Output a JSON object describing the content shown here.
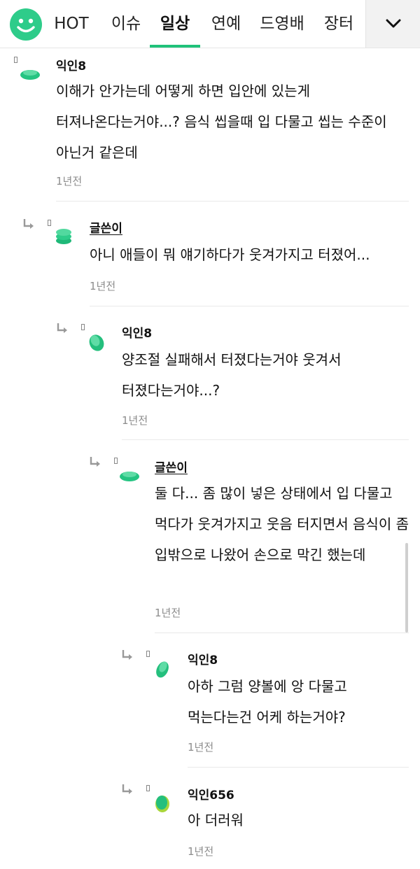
{
  "tabs": [
    {
      "label": "HOT"
    },
    {
      "label": "이슈"
    },
    {
      "label": "일상"
    },
    {
      "label": "연예"
    },
    {
      "label": "드영배"
    },
    {
      "label": "장터"
    }
  ],
  "active_tab": "일상",
  "accent_color": "#20c27a",
  "comments": [
    {
      "author": "익인8",
      "text": "이해가 안가는데 어떻게 하면 입안에 있는게 터져나온다는거야...? 음식 씹을때 입 다물고 씹는 수준이 아닌거 같은데",
      "time": "1년전"
    },
    {
      "author": "글쓴이",
      "text": "아니 애들이 뭐 얘기하다가 웃겨가지고 터졌어...",
      "time": "1년전"
    },
    {
      "author": "익인8",
      "text": "양조절 실패해서 터졌다는거야 웃겨서 터졌다는거야...?",
      "time": "1년전"
    },
    {
      "author": "글쓴이",
      "text": "둘 다... 좀 많이 넣은 상태에서 입 다물고 먹다가 웃겨가지고 웃음 터지면서 음식이 좀 입밖으로 나왔어 손으로 막긴 했는데",
      "time": "1년전"
    },
    {
      "author": "익인8",
      "text": "아하 그럼 양볼에 앙 다물고 먹는다는건 어케 하는거야?",
      "time": "1년전"
    },
    {
      "author": "익인656",
      "text": "아 더러워",
      "time": "1년전"
    }
  ]
}
